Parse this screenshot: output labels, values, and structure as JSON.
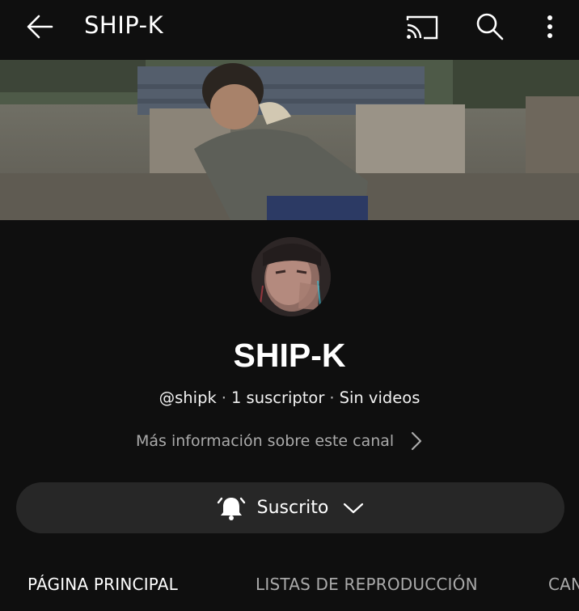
{
  "header": {
    "title": "SHIP-K",
    "icons": [
      "back-arrow-icon",
      "cast-icon",
      "search-icon",
      "more-vert-icon"
    ]
  },
  "channel": {
    "name": "SHIP-K",
    "handle": "@shipk",
    "subscribers": "1 suscriptor",
    "videos": "Sin videos",
    "more_info": "Más información sobre este canal"
  },
  "subscribe_button": {
    "label": "Suscrito",
    "icons": [
      "bell-icon",
      "chevron-down-icon"
    ]
  },
  "tabs": [
    {
      "label": "PÁGINA PRINCIPAL",
      "active": true
    },
    {
      "label": "LISTAS DE REPRODUCCIÓN",
      "active": false
    },
    {
      "label": "CAN",
      "active": false
    }
  ],
  "colors": {
    "background": "#0f0f0f",
    "button": "#272727",
    "text": "#f1f1f1",
    "muted": "#aaaaaa"
  }
}
